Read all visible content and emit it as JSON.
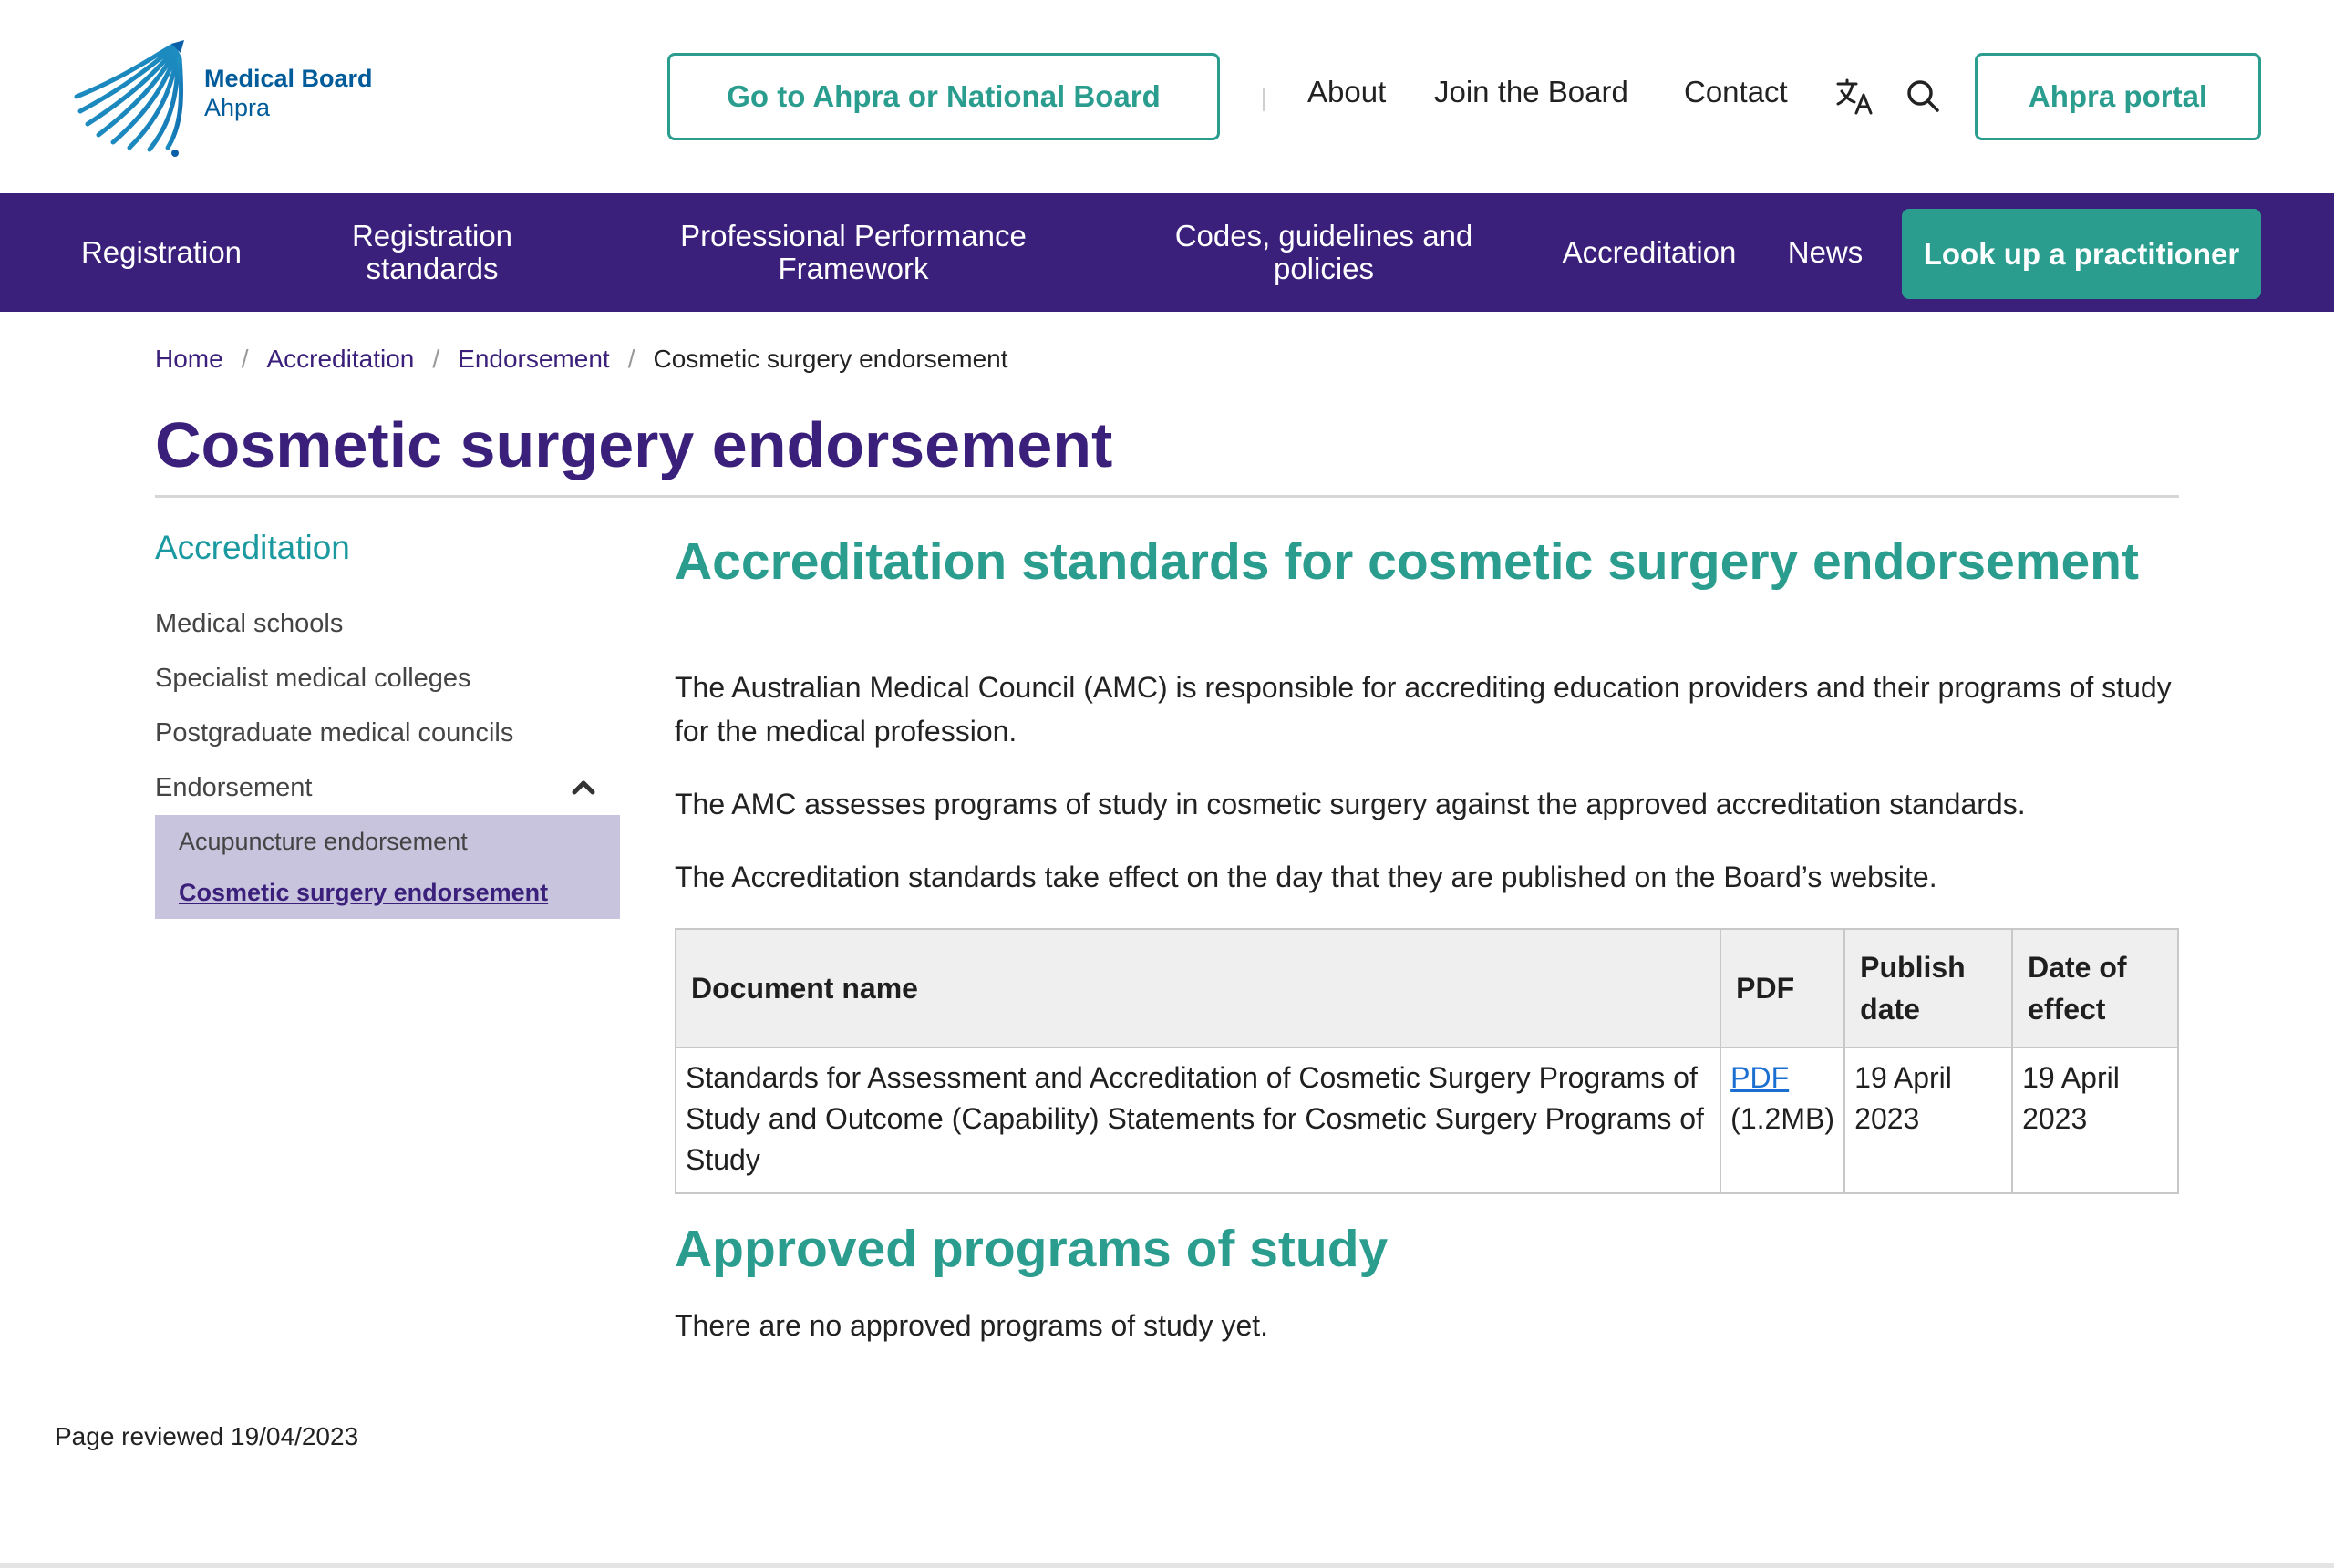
{
  "header": {
    "logo_line1": "Medical Board",
    "logo_line2": "Ahpra",
    "goto_button": "Go to Ahpra or National Board",
    "links": [
      "About",
      "Join the Board",
      "Contact"
    ],
    "translate_icon": "translate-icon",
    "search_icon": "search-icon",
    "portal_button": "Ahpra portal"
  },
  "nav": {
    "items": [
      "Registration",
      "Registration standards",
      "Professional Performance Framework",
      "Codes, guidelines and policies",
      "Accreditation",
      "News"
    ],
    "lookup_button": "Look up a practitioner"
  },
  "breadcrumb": {
    "items": [
      "Home",
      "Accreditation",
      "Endorsement"
    ],
    "current": "Cosmetic surgery endorsement"
  },
  "page_title": "Cosmetic surgery endorsement",
  "sidebar": {
    "heading": "Accreditation",
    "items": [
      "Medical schools",
      "Specialist medical colleges",
      "Postgraduate medical councils",
      "Endorsement"
    ],
    "subitems": [
      "Acupuncture endorsement",
      "Cosmetic surgery endorsement"
    ]
  },
  "content": {
    "heading1": "Accreditation standards for cosmetic surgery endorsement",
    "para1": "The Australian Medical Council (AMC) is responsible for accrediting education providers and their programs of study for the medical profession.",
    "para2": "The AMC assesses programs of study in cosmetic surgery against the approved accreditation standards.",
    "para3": "The Accreditation standards take effect on the day that they are published on the Board’s website.",
    "table": {
      "headers": [
        "Document name",
        "PDF",
        "Publish date",
        "Date of effect"
      ],
      "rows": [
        {
          "name": "Standards for Assessment and Accreditation of Cosmetic Surgery Programs of Study and Outcome (Capability) Statements for Cosmetic Surgery Programs of Study",
          "pdf_link": "PDF",
          "pdf_size": "(1.2MB)",
          "publish_date": "19 April 2023",
          "effect_date": "19 April 2023"
        }
      ]
    },
    "heading2": "Approved programs of study",
    "para4": "There are no approved programs of study yet."
  },
  "footer": {
    "reviewed": "Page reviewed 19/04/2023"
  },
  "colors": {
    "brand_purple": "#3a1f7b",
    "accent_teal": "#2a9d8f",
    "logo_blue": "#005b9a",
    "subnav_bg": "#c9c4de"
  }
}
